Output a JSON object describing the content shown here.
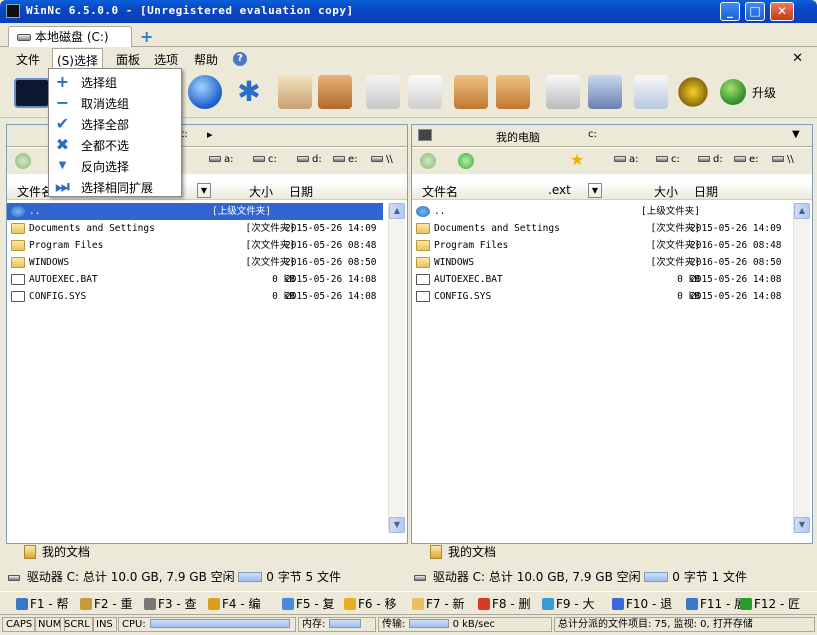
{
  "window": {
    "title": "WinNc 6.5.0.0 - [Unregistered evaluation copy]"
  },
  "tabs": {
    "disk_tab": "本地磁盘 (C:)"
  },
  "menu": {
    "file": "文件",
    "select": "(S)选择",
    "panel": "面板",
    "options": "选项",
    "help": "帮助"
  },
  "select_menu": [
    {
      "label": "选择组",
      "icon": "plus-icon"
    },
    {
      "label": "取消选组",
      "icon": "minus-icon"
    },
    {
      "label": "选择全部",
      "icon": "checkmark-icon"
    },
    {
      "label": "全都不选",
      "icon": "x-icon"
    },
    {
      "label": "反向选择",
      "icon": "arrow-down-icon"
    },
    {
      "label": "选择相同扩展",
      "icon": "skip-forward-icon"
    }
  ],
  "toolbar": {
    "upgrade": "升级"
  },
  "left": {
    "path": "c:",
    "drives": [
      "a:",
      "c:",
      "d:",
      "e:",
      "\\\\"
    ],
    "hdr": {
      "name": "文件名",
      "size": "大小",
      "date": "日期"
    },
    "rows": [
      {
        "name": "..",
        "size": "[上级文件夹]",
        "date": "",
        "type": "up"
      },
      {
        "name": "Documents and Settings",
        "size": "[次文件夹]",
        "date": "2015-05-26 14:09",
        "type": "dir"
      },
      {
        "name": "Program Files",
        "size": "[次文件夹]",
        "date": "2016-05-26 08:48",
        "type": "dir"
      },
      {
        "name": "WINDOWS",
        "size": "[次文件夹]",
        "date": "2016-05-26 08:50",
        "type": "dir"
      },
      {
        "name": "AUTOEXEC.BAT",
        "size": "0 kB",
        "date": "2015-05-26 14:08",
        "type": "file"
      },
      {
        "name": "CONFIG.SYS",
        "size": "0 kB",
        "date": "2015-05-26 14:08",
        "type": "file"
      }
    ],
    "doctab": "我的文档",
    "status": "驱动器 C: 总计 10.0 GB, 7.9 GB 空闲",
    "status2": "0 字节 5 文件"
  },
  "right": {
    "path": "我的电脑",
    "path2": "c:",
    "drives": [
      "a:",
      "c:",
      "d:",
      "e:",
      "\\\\"
    ],
    "hdr": {
      "name": "文件名",
      "ext": ".ext",
      "size": "大小",
      "date": "日期"
    },
    "rows": [
      {
        "name": "..",
        "size": "[上级文件夹]",
        "date": "",
        "type": "up"
      },
      {
        "name": "Documents and Settings",
        "size": "[次文件夹]",
        "date": "2015-05-26 14:09",
        "type": "dir"
      },
      {
        "name": "Program Files",
        "size": "[次文件夹]",
        "date": "2016-05-26 08:48",
        "type": "dir"
      },
      {
        "name": "WINDOWS",
        "size": "[次文件夹]",
        "date": "2016-05-26 08:50",
        "type": "dir"
      },
      {
        "name": "AUTOEXEC.BAT",
        "size": "0 kB",
        "date": "2015-05-26 14:08",
        "type": "file"
      },
      {
        "name": "CONFIG.SYS",
        "size": "0 kB",
        "date": "2015-05-26 14:08",
        "type": "file"
      }
    ],
    "doctab": "我的文档",
    "status": "驱动器 C: 总计 10.0 GB, 7.9 GB 空闲",
    "status2": "0 字节 1 文件"
  },
  "fkeys": [
    "F1 - 帮",
    "F2 - 重",
    "F3 - 查",
    "F4 - 编",
    "F5 - 复",
    "F6 - 移",
    "F7 - 新",
    "F8 - 删",
    "F9 - 大",
    "F10 - 退",
    "F11 - 展",
    "F12 - 匠"
  ],
  "bottom": {
    "caps": "CAPS",
    "num": "NUM",
    "scrl": "SCRL",
    "ins": "INS",
    "cpu": "CPU:",
    "mem": "内存:",
    "transfer": "传输:",
    "rate": "0 kB/sec",
    "total": "总计分派的文件项目: 75, 监视: 0, 打开存储"
  }
}
